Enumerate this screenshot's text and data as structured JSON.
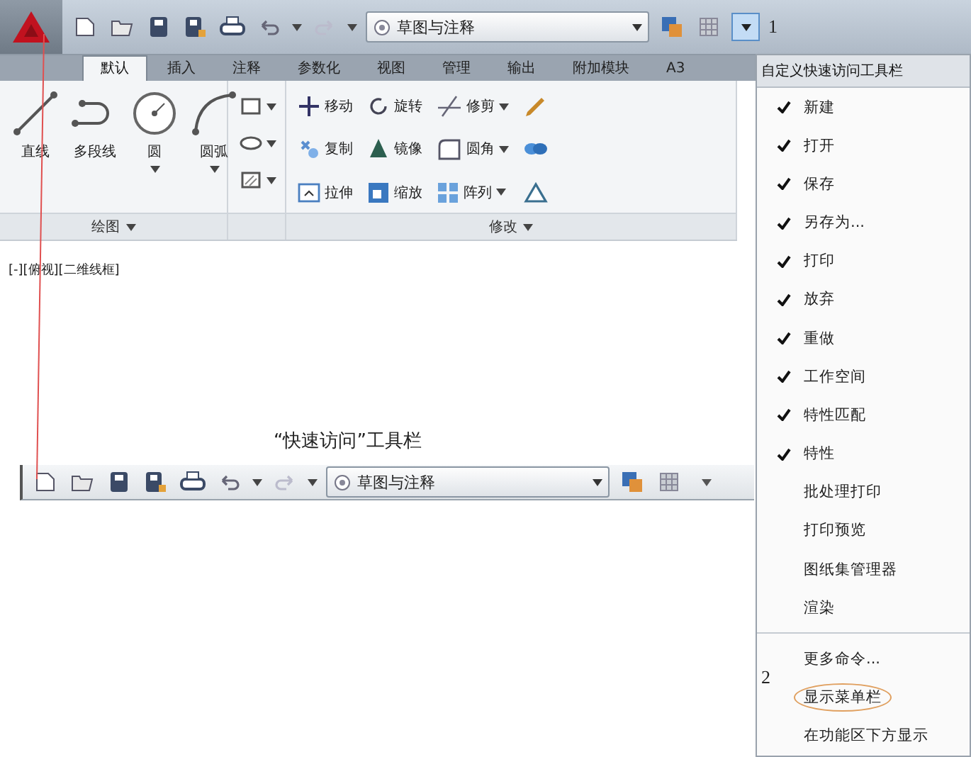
{
  "quick_access_toolbar": {
    "workspace": "草图与注释",
    "callout": "1"
  },
  "ribbon": {
    "tabs": [
      {
        "label": "默认",
        "selected": true
      },
      {
        "label": "插入",
        "selected": false
      },
      {
        "label": "注释",
        "selected": false
      },
      {
        "label": "参数化",
        "selected": false
      },
      {
        "label": "视图",
        "selected": false
      },
      {
        "label": "管理",
        "selected": false
      },
      {
        "label": "输出",
        "selected": false
      },
      {
        "label": "附加模块",
        "selected": false
      },
      {
        "label": "A3",
        "selected": false
      }
    ],
    "draw_panel": {
      "title": "绘图",
      "tools": [
        {
          "label": "直线",
          "dropdown": false
        },
        {
          "label": "多段线",
          "dropdown": false
        },
        {
          "label": "圆",
          "dropdown": true
        },
        {
          "label": "圆弧",
          "dropdown": true
        }
      ]
    },
    "modify_panel": {
      "title": "修改",
      "tools": [
        {
          "label": "移动",
          "dropdown": false
        },
        {
          "label": "旋转",
          "dropdown": false
        },
        {
          "label": "修剪",
          "dropdown": true
        },
        {
          "label": "复制",
          "dropdown": false
        },
        {
          "label": "镜像",
          "dropdown": false
        },
        {
          "label": "圆角",
          "dropdown": true
        },
        {
          "label": "拉伸",
          "dropdown": false
        },
        {
          "label": "缩放",
          "dropdown": false
        },
        {
          "label": "阵列",
          "dropdown": true
        }
      ]
    }
  },
  "viewport_label": "[-][俯视][二维线框]",
  "caption": "“快速访问”工具栏",
  "floating_toolbar": {
    "workspace": "草图与注释"
  },
  "menu": {
    "title": "自定义快速访问工具栏",
    "callout": "2",
    "items": [
      {
        "label": "新建",
        "checked": true,
        "highlighted": false
      },
      {
        "label": "打开",
        "checked": true,
        "highlighted": false
      },
      {
        "label": "保存",
        "checked": true,
        "highlighted": false
      },
      {
        "label": "另存为...",
        "checked": true,
        "highlighted": false
      },
      {
        "label": "打印",
        "checked": true,
        "highlighted": false
      },
      {
        "label": "放弃",
        "checked": true,
        "highlighted": false
      },
      {
        "label": "重做",
        "checked": true,
        "highlighted": false
      },
      {
        "label": "工作空间",
        "checked": true,
        "highlighted": false
      },
      {
        "label": "特性匹配",
        "checked": true,
        "highlighted": false
      },
      {
        "label": "特性",
        "checked": true,
        "highlighted": false
      },
      {
        "label": "批处理打印",
        "checked": false,
        "highlighted": false
      },
      {
        "label": "打印预览",
        "checked": false,
        "highlighted": false
      },
      {
        "label": "图纸集管理器",
        "checked": false,
        "highlighted": false
      },
      {
        "label": "渲染",
        "checked": false,
        "highlighted": false
      }
    ],
    "extra_items": [
      {
        "label": "更多命令...",
        "highlighted": false
      },
      {
        "label": "显示菜单栏",
        "highlighted": true
      },
      {
        "label": "在功能区下方显示",
        "highlighted": false
      }
    ]
  }
}
